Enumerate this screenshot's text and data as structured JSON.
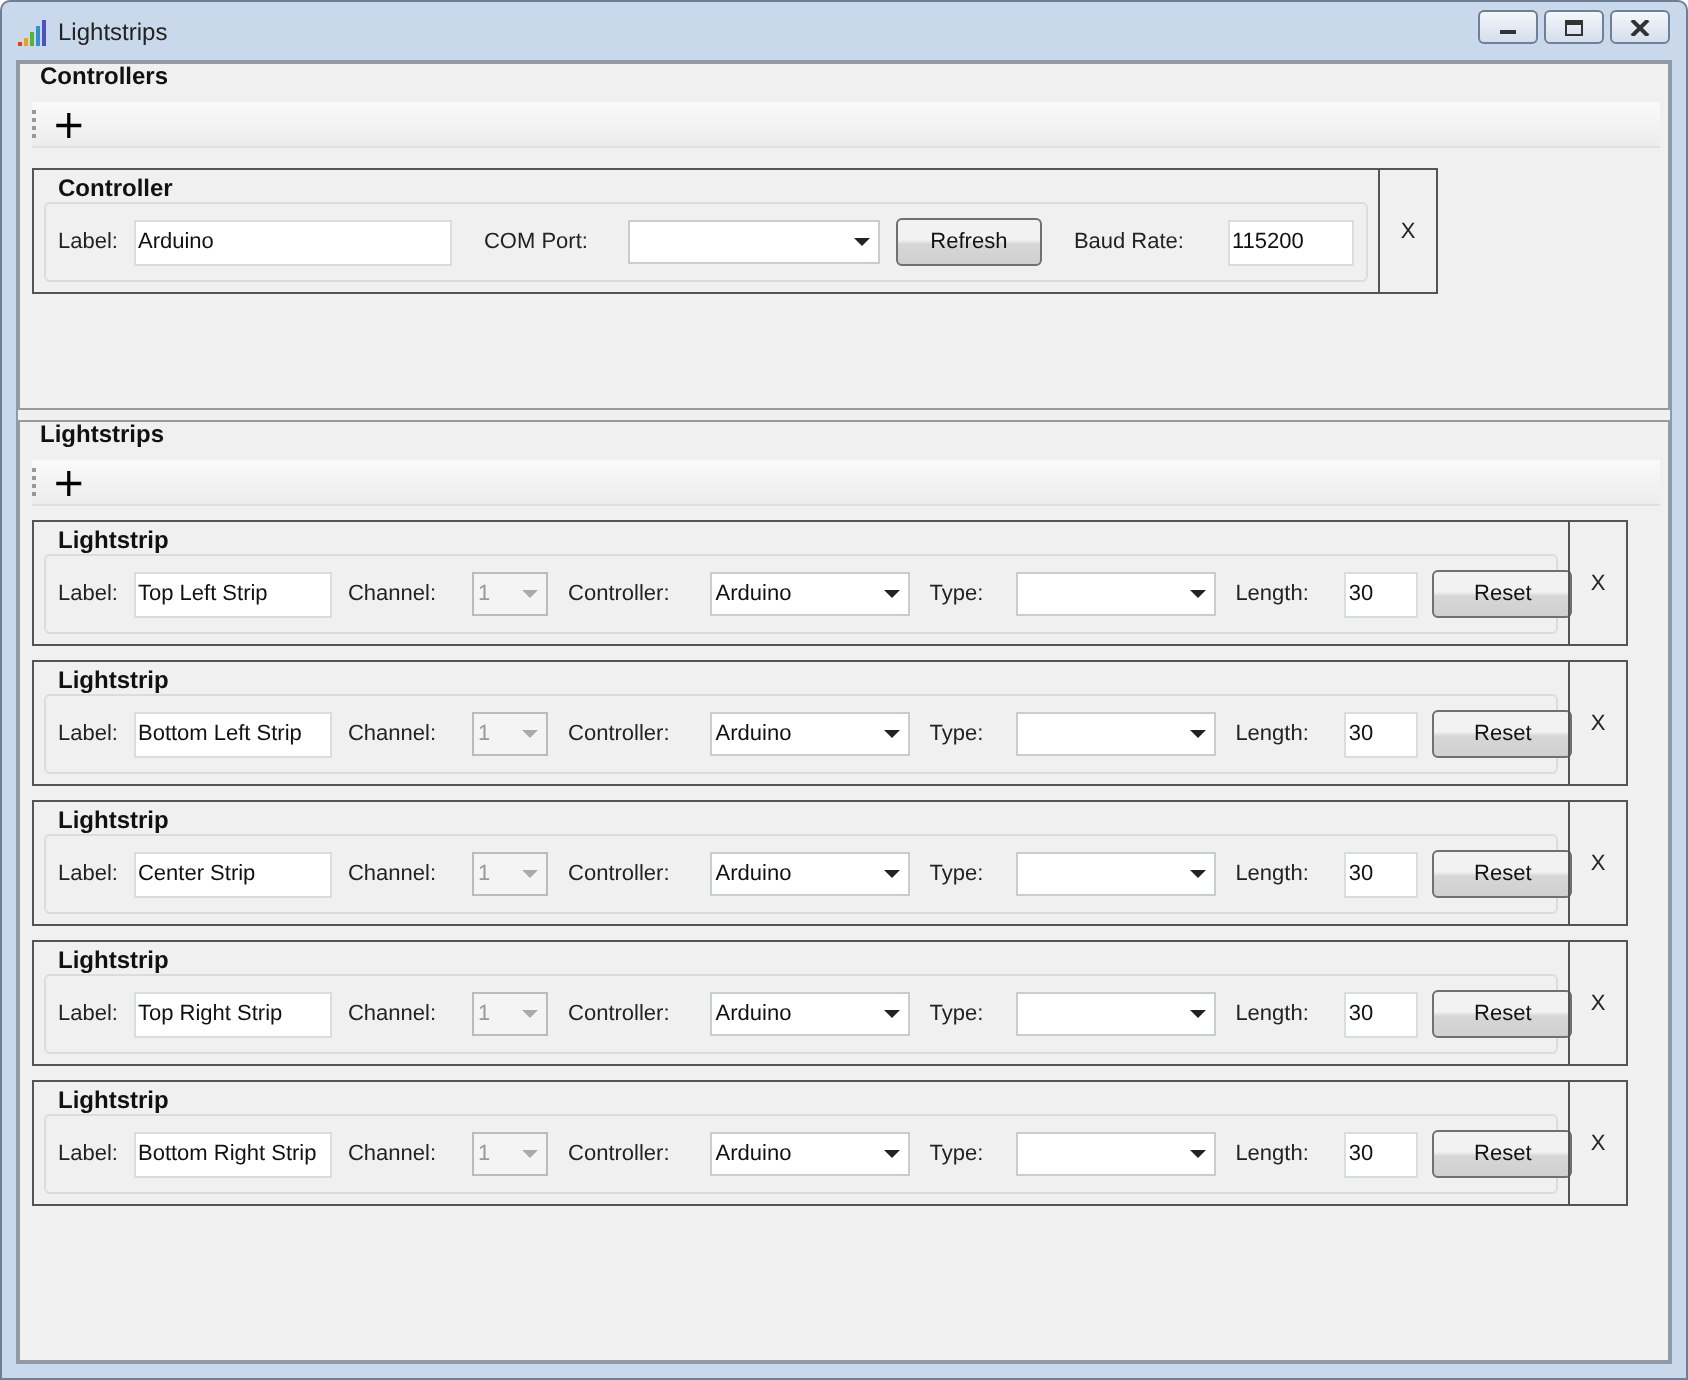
{
  "window": {
    "title": "Lightstrips"
  },
  "controllers": {
    "title": "Controllers",
    "add_button": "+",
    "items": [
      {
        "title": "Controller",
        "label_caption": "Label:",
        "label": "Arduino",
        "com_caption": "COM Port:",
        "refresh": "Refresh",
        "baud_caption": "Baud Rate:",
        "baud_rate": "115200",
        "remove": "X"
      }
    ]
  },
  "lightstrips": {
    "title": "Lightstrips",
    "add_button": "+",
    "items": [
      {
        "title": "Lightstrip",
        "label_caption": "Label:",
        "label": "Top Left Strip",
        "channel_caption": "Channel:",
        "channel": "1",
        "channel_disabled": true,
        "controller_caption": "Controller:",
        "controller": "Arduino",
        "type_caption": "Type:",
        "length_caption": "Length:",
        "length": "30",
        "reset": "Reset",
        "remove": "X"
      },
      {
        "title": "Lightstrip",
        "label_caption": "Label:",
        "label": "Bottom Left Strip",
        "channel_caption": "Channel:",
        "channel": "1",
        "channel_disabled": true,
        "controller_caption": "Controller:",
        "controller": "Arduino",
        "type_caption": "Type:",
        "length_caption": "Length:",
        "length": "30",
        "reset": "Reset",
        "remove": "X"
      },
      {
        "title": "Lightstrip",
        "label_caption": "Label:",
        "label": "Center Strip",
        "channel_caption": "Channel:",
        "channel": "1",
        "channel_disabled": true,
        "controller_caption": "Controller:",
        "controller": "Arduino",
        "type_caption": "Type:",
        "length_caption": "Length:",
        "length": "30",
        "reset": "Reset",
        "remove": "X"
      },
      {
        "title": "Lightstrip",
        "label_caption": "Label:",
        "label": "Top Right Strip",
        "channel_caption": "Channel:",
        "channel": "1",
        "channel_disabled": true,
        "controller_caption": "Controller:",
        "controller": "Arduino",
        "type_caption": "Type:",
        "length_caption": "Length:",
        "length": "30",
        "reset": "Reset",
        "remove": "X"
      },
      {
        "title": "Lightstrip",
        "label_caption": "Label:",
        "label": "Bottom Right Strip",
        "channel_caption": "Channel:",
        "channel": "1",
        "channel_disabled": true,
        "controller_caption": "Controller:",
        "controller": "Arduino",
        "type_caption": "Type:",
        "length_caption": "Length:",
        "length": "30",
        "reset": "Reset",
        "remove": "X"
      }
    ]
  }
}
